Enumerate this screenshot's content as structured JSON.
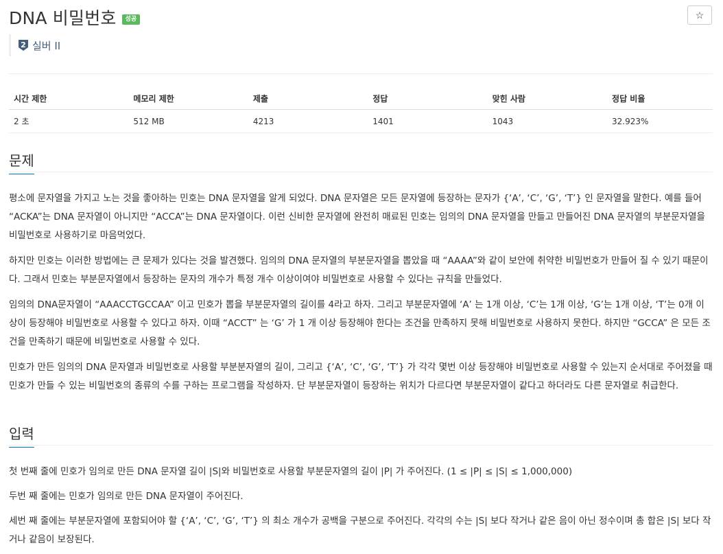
{
  "problem": {
    "title": "DNA 비밀번호",
    "status_badge": "성공",
    "star_icon": "☆",
    "tier_number": "2",
    "tier_label": "실버 II"
  },
  "info_table": {
    "headers": [
      "시간 제한",
      "메모리 제한",
      "제출",
      "정답",
      "맞힌 사람",
      "정답 비율"
    ],
    "values": [
      "2 초",
      "512 MB",
      "4213",
      "1401",
      "1043",
      "32.923%"
    ]
  },
  "sections": {
    "problem": {
      "heading": "문제",
      "paragraphs": [
        "평소에 문자열을 가지고 노는 것을 좋아하는 민호는 DNA 문자열을 알게 되었다. DNA 문자열은 모든 문자열에 등장하는 문자가 {‘A’, ‘C’, ‘G’, ‘T’} 인 문자열을 말한다. 예를 들어 “ACKA”는 DNA 문자열이 아니지만 “ACCA”는 DNA 문자열이다. 이런 신비한 문자열에 완전히 매료된 민호는 임의의 DNA 문자열을 만들고 만들어진 DNA 문자열의 부분문자열을 비밀번호로 사용하기로 마음먹었다.",
        "하지만 민호는 이러한 방법에는 큰 문제가 있다는 것을 발견했다. 임의의 DNA 문자열의 부분문자열을 뽑았을 때 “AAAA”와 같이 보안에 취약한 비밀번호가 만들어 질 수 있기 때문이다. 그래서 민호는 부분문자열에서 등장하는 문자의 개수가 특정 개수 이상이여야 비밀번호로 사용할 수 있다는 규칙을 만들었다.",
        "임의의 DNA문자열이 “AAACCTGCCAA” 이고 민호가 뽑을 부분문자열의 길이를 4라고 하자. 그리고 부분문자열에 ‘A’ 는 1개 이상, ‘C’는 1개 이상, ‘G’는 1개 이상, ‘T’는 0개 이상이 등장해야 비밀번호로 사용할 수 있다고 하자. 이때 “ACCT” 는 ‘G’ 가 1 개 이상 등장해야 한다는 조건을 만족하지 못해 비밀번호로 사용하지 못한다. 하지만 “GCCA” 은 모든 조건을 만족하기 때문에 비밀번호로 사용할 수 있다.",
        "민호가 만든 임의의 DNA 문자열과 비밀번호로 사용할 부분분자열의 길이, 그리고 {‘A’, ‘C’, ‘G’, ‘T’} 가 각각 몇번 이상 등장해야 비밀번호로 사용할 수 있는지 순서대로 주어졌을 때 민호가 만들 수 있는 비밀번호의 종류의 수를 구하는 프로그램을 작성하자. 단 부분문자열이 등장하는 위치가 다르다면 부분문자열이 같다고 하더라도 다른 문자열로 취급한다."
      ]
    },
    "input": {
      "heading": "입력",
      "paragraphs": [
        "첫 번째 줄에 민호가 임의로 만든 DNA 문자열 길이 |S|와 비밀번호로 사용할 부분문자열의 길이 |P| 가 주어진다. (1 ≤ |P| ≤ |S| ≤ 1,000,000)",
        "두번 째 줄에는 민호가 임의로 만든 DNA 문자열이 주어진다.",
        "세번 째 줄에는 부분문자열에 포함되어야 할 {‘A’, ‘C’, ‘G’, ‘T’} 의 최소 개수가 공백을 구분으로 주어진다. 각각의 수는 |S| 보다 작거나 같은 음이 아닌 정수이며 총 합은 |S| 보다 작거나 같음이 보장된다."
      ]
    }
  },
  "colors": {
    "badge_green": "#5cb85c",
    "tier_silver": "#435f7a",
    "section_underline": "#0076c0"
  }
}
